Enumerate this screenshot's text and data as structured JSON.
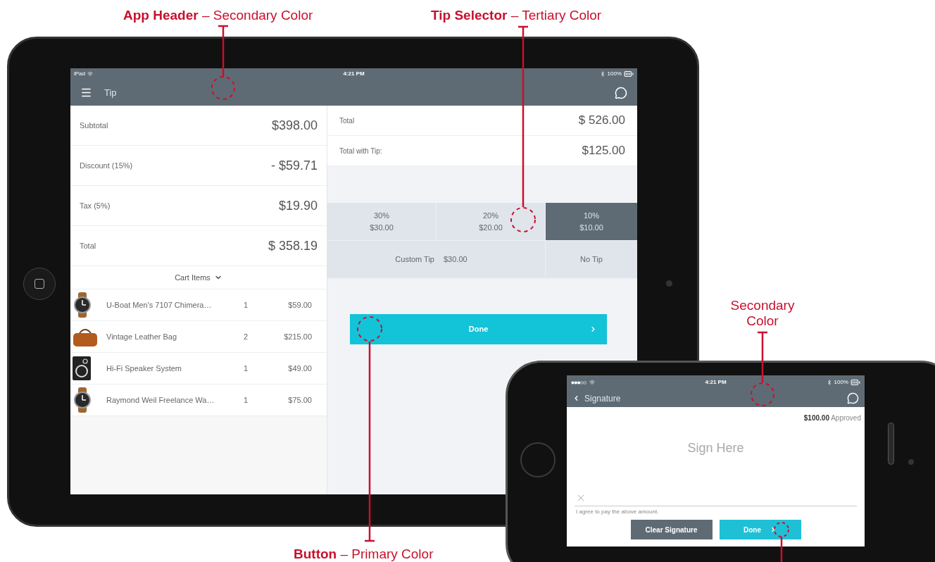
{
  "annotations": [
    {
      "text": "**App Header** – Secondary Color"
    },
    {
      "text": "**Tip Selector** – Tertiary Color"
    },
    {
      "text": "Secondary Color"
    },
    {
      "text": "**Button** – Primary Color"
    }
  ],
  "tablet": {
    "status_bar": {
      "device": "iPad",
      "time": "4:21 PM",
      "battery": "100%"
    },
    "header": {
      "title": "Tip"
    },
    "summary": [
      {
        "label": "Subtotal",
        "value": "$398.00"
      },
      {
        "label": "Discount (15%)",
        "value": "- $59.71"
      },
      {
        "label": "Tax (5%)",
        "value": "$19.90"
      },
      {
        "label": "Total",
        "value": "$ 358.19"
      }
    ],
    "cart_toggle": "Cart Items",
    "cart_items": [
      {
        "kind": "watch",
        "name": "U-Boat Men's 7107 Chimera…",
        "qty": "1",
        "price": "$59.00"
      },
      {
        "kind": "bag",
        "name": "Vintage Leather Bag",
        "qty": "2",
        "price": "$215.00"
      },
      {
        "kind": "speaker",
        "name": "Hi-Fi Speaker System",
        "qty": "1",
        "price": "$49.00"
      },
      {
        "kind": "watch",
        "name": "Raymond Weil Freelance Wa…",
        "qty": "1",
        "price": "$75.00"
      }
    ],
    "totals": [
      {
        "label": "Total",
        "value": "$ 526.00"
      },
      {
        "label": "Total with Tip:",
        "value": "$125.00"
      }
    ],
    "tip_options": [
      {
        "percent": "30%",
        "amount": "$30.00",
        "selected": false
      },
      {
        "percent": "20%",
        "amount": "$20.00",
        "selected": false
      },
      {
        "percent": "10%",
        "amount": "$10.00",
        "selected": true
      }
    ],
    "custom_tip": {
      "label": "Custom Tip",
      "value": "$30.00"
    },
    "no_tip": "No Tip",
    "done_button": "Done"
  },
  "phone": {
    "status_bar": {
      "time": "4:21 PM",
      "battery": "100%"
    },
    "header": {
      "title": "Signature"
    },
    "approval": "**$100.00** Approved",
    "sign_placeholder": "Sign Here",
    "agreement": "I agree to pay the above amount.",
    "buttons": [
      {
        "kind": "secondary",
        "label": "Clear Signature"
      },
      {
        "kind": "primary",
        "label": "Done"
      }
    ]
  }
}
